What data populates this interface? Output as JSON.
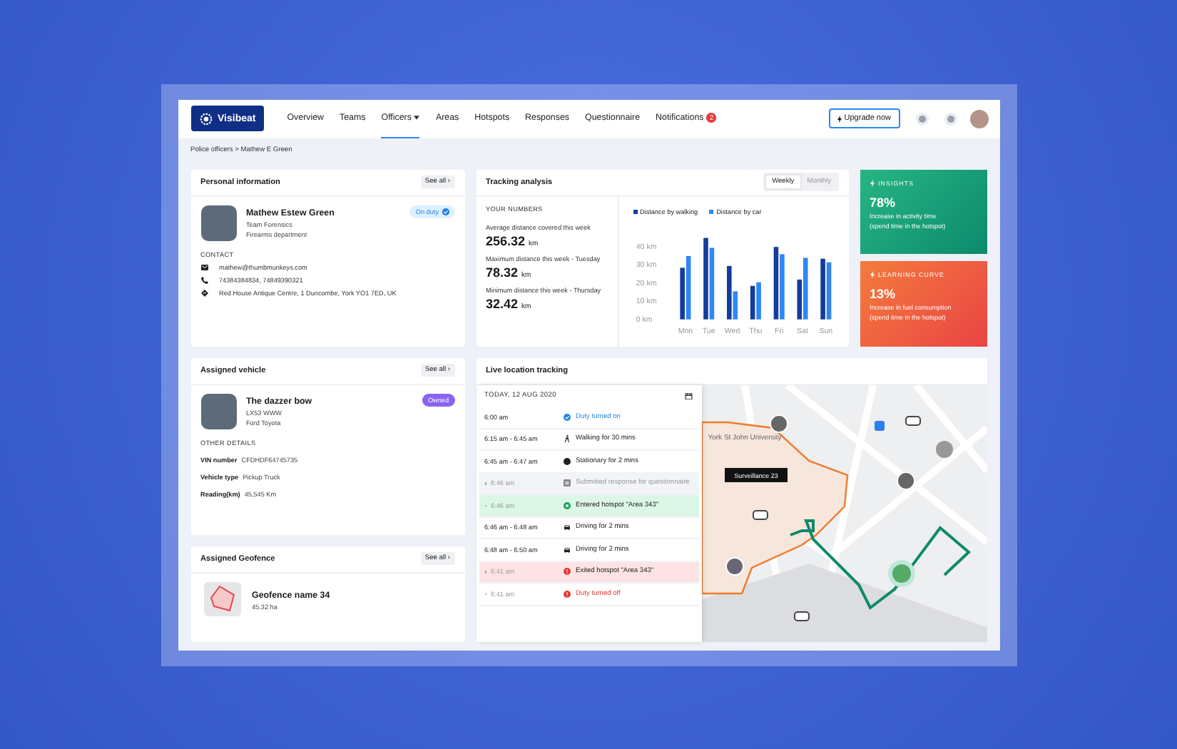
{
  "app": {
    "logo": "Visibeat",
    "upgrade_button": "Upgrade now"
  },
  "nav": [
    {
      "label": "Overview",
      "selected": false,
      "dropdown": false
    },
    {
      "label": "Teams",
      "selected": false,
      "dropdown": false
    },
    {
      "label": "Officers",
      "selected": true,
      "dropdown": true
    },
    {
      "label": "Areas",
      "selected": false,
      "dropdown": false
    },
    {
      "label": "Hotspots",
      "selected": false,
      "dropdown": false
    },
    {
      "label": "Responses",
      "selected": false,
      "dropdown": false
    },
    {
      "label": "Questionnaire",
      "selected": false,
      "dropdown": false
    },
    {
      "label": "Notifications",
      "selected": false,
      "dropdown": false,
      "badge": "2"
    }
  ],
  "breadcrumb": "Police officers > Mathew E Green",
  "personal": {
    "title": "Personal information",
    "see_all": "See all ›",
    "name": "Mathew Estew Green",
    "team": "Team Forensics",
    "department": "Firearms department",
    "status": "On duty",
    "contact_heading": "CONTACT",
    "contacts": [
      {
        "kind": "email",
        "text": "mathew@thumbmunkeys.com"
      },
      {
        "kind": "phone",
        "text": "74384384834,  74849390321"
      },
      {
        "kind": "address",
        "text": "Red House Antique Centre, 1 Duncombe, York YO1 7ED, UK"
      }
    ]
  },
  "tracking": {
    "title": "Tracking analysis",
    "periods": [
      {
        "label": "Weekly",
        "selected": true
      },
      {
        "label": "Monthly",
        "selected": false
      }
    ],
    "numbers_heading": "YOUR NUMBERS",
    "stats": [
      {
        "label": "Average distance covered this week",
        "value": "256.32",
        "unit": "km"
      },
      {
        "label": "Maximum distance this week - Tuesday",
        "value": "78.32",
        "unit": "km"
      },
      {
        "label": "Minimum distance this week - Thursday",
        "value": "32.42",
        "unit": "km"
      }
    ],
    "chart_data": {
      "type": "bar",
      "legend": "top",
      "categories": [
        "Mon",
        "Tue",
        "Wed",
        "Thu",
        "Fri",
        "Sat",
        "Sun"
      ],
      "series": [
        {
          "name": "Distance by walking",
          "color": "#143c9a",
          "values": [
            28.5,
            45,
            29.5,
            18.5,
            40,
            22,
            33.5
          ]
        },
        {
          "name": "Distance by car",
          "color": "#2f86f6",
          "values": [
            35,
            39.5,
            15.5,
            20.5,
            36,
            34,
            31.5
          ]
        }
      ],
      "ylim": [
        0,
        46
      ],
      "yticks": [
        {
          "value": 0,
          "label": "0 km"
        },
        {
          "value": 10,
          "label": "10 km"
        },
        {
          "value": 20,
          "label": "20 km"
        },
        {
          "value": 30,
          "label": "30 km"
        },
        {
          "value": 40,
          "label": "40 km"
        }
      ]
    }
  },
  "insights": [
    {
      "kind": "insights",
      "title": "INSIGHTS",
      "value": "78%",
      "text": "Increase in activity time",
      "note": "(spend time in the hotspot)"
    },
    {
      "kind": "learning",
      "title": "LEARNING CURVE",
      "value": "13%",
      "text": "Increase in fuel consumption",
      "note": "(spend time in the hotspot)"
    }
  ],
  "vehicle": {
    "title": "Assigned vehicle",
    "see_all": "See all ›",
    "name": "The dazzer bow",
    "plate": "LX53 WWW",
    "model": "Ford Toyota",
    "status": "Owned",
    "details_heading": "OTHER DETAILS",
    "details": [
      {
        "label": "VIN number",
        "value": "CFDHDF64745735"
      },
      {
        "label": "Vehicle type",
        "value": "Pickup Truck"
      },
      {
        "label": "Reading(km)",
        "value": "45,545 Km"
      }
    ]
  },
  "geofence": {
    "title": "Assigned Geofence",
    "see_all": "See all ›",
    "name": "Geofence name 34",
    "area": "45.32 ha"
  },
  "live": {
    "title": "Live location tracking",
    "date": "TODAY, 12 AUG 2020",
    "events": [
      {
        "kind": "on",
        "time": "6:00 am",
        "text": "Duty turned on"
      },
      {
        "kind": "walking",
        "time": "6:15 am - 6:45 am",
        "text": "Walking for 30 mins"
      },
      {
        "kind": "stationary",
        "time": "6:45 am - 6:47 am",
        "text": "Stationary for 2 mins"
      },
      {
        "kind": "response",
        "time": "6:46 am",
        "text": "Submitted response for questionnaire"
      },
      {
        "kind": "entered",
        "time": "6:46 am",
        "text": "Entered hotspot \"Area 343\""
      },
      {
        "kind": "driving",
        "time": "6:46 am - 6:48 am",
        "text": "Driving for 2 mins"
      },
      {
        "kind": "driving",
        "time": "6:48 am - 6:50 am",
        "text": "Driving for 2 mins"
      },
      {
        "kind": "exited",
        "time": "6:41 am",
        "text": "Exited hotspot \"Area 343\""
      },
      {
        "kind": "off",
        "time": "6:41 am",
        "text": "Duty turned off"
      }
    ],
    "map": {
      "place": "York St John University",
      "tooltip": "Surveillance 23"
    }
  }
}
